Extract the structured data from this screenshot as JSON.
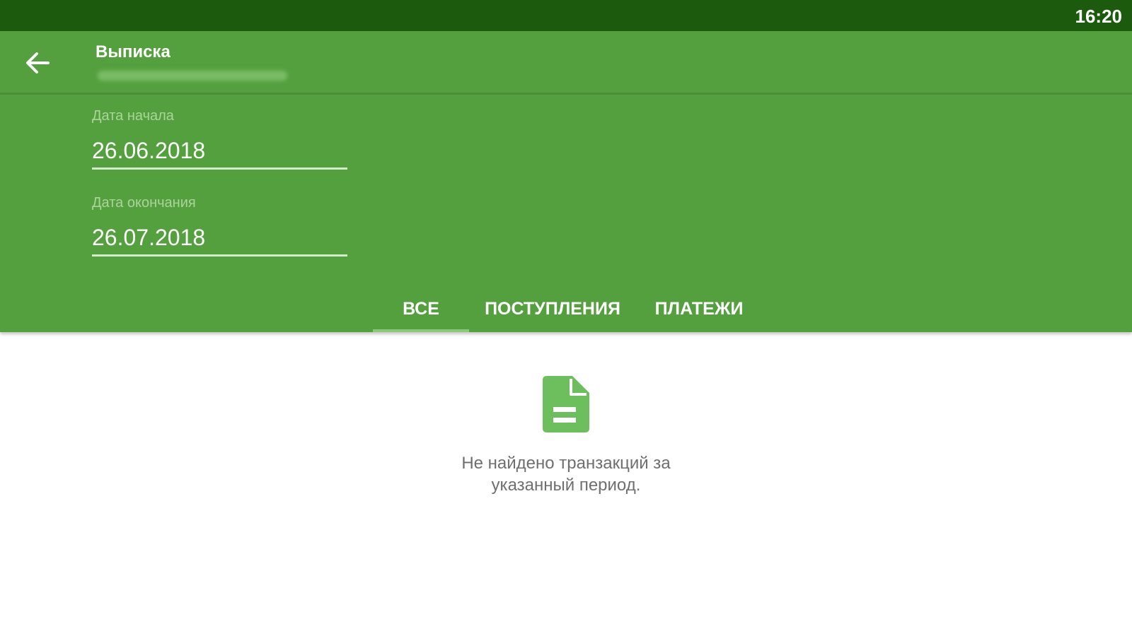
{
  "status_bar": {
    "time": "16:20"
  },
  "app_bar": {
    "back_icon": "arrow-left-icon",
    "title": "Выписка",
    "subtitle_blurred": true
  },
  "filters": {
    "start_date": {
      "label": "Дата начала",
      "value": "26.06.2018"
    },
    "end_date": {
      "label": "Дата окончания",
      "value": "26.07.2018"
    }
  },
  "tabs": [
    {
      "label": "ВСЕ",
      "selected": true
    },
    {
      "label": "ПОСТУПЛЕНИЯ",
      "selected": false
    },
    {
      "label": "ПЛАТЕЖИ",
      "selected": false
    }
  ],
  "empty_state": {
    "icon": "document-icon",
    "message_line1": "Не найдено транзакций за",
    "message_line2": "указанный период."
  },
  "colors": {
    "status_bar": "#1c5a0d",
    "primary": "#55a03e",
    "tab_indicator": "#8cc97a",
    "icon_fill": "#6cbf5c",
    "label_text": "#a9d59a",
    "empty_text": "#6f6f6f"
  }
}
